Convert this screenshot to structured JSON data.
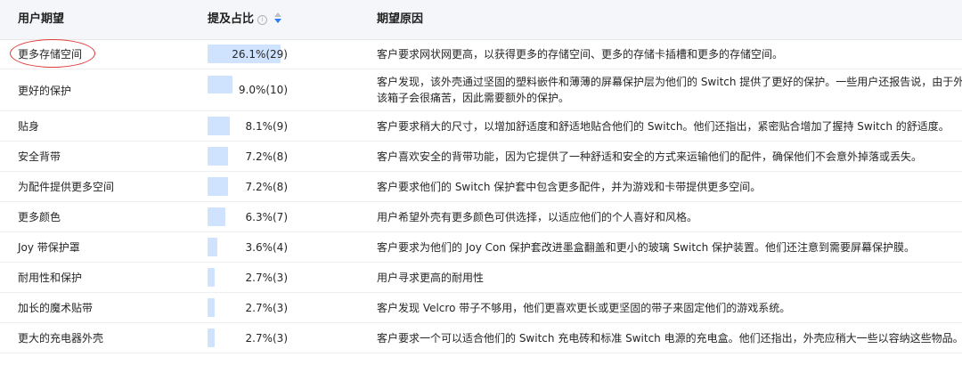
{
  "columns": {
    "expectation": "用户期望",
    "share": "提及占比",
    "info_glyph": "i",
    "reason": "期望原因"
  },
  "rows": [
    {
      "name": "更多存储空间",
      "share": 0.261,
      "pct": "26.1%(29)",
      "reason": "客户要求网状网更高，以获得更多的存储空间、更多的存储卡插槽和更多的存储空间。"
    },
    {
      "name": "更好的保护",
      "share": 0.09,
      "pct": "9.0%(10)",
      "reason": "客户发现，该外壳通过坚固的塑料嵌件和薄薄的屏幕保护层为他们的 Switch 提供了更好的保护。一些用户还报告说，由于外",
      "reason2": "该箱子会很痛苦，因此需要额外的保护。"
    },
    {
      "name": "贴身",
      "share": 0.081,
      "pct": "8.1%(9)",
      "reason": "客户要求稍大的尺寸，以增加舒适度和舒适地贴合他们的 Switch。他们还指出，紧密贴合增加了握持 Switch 的舒适度。"
    },
    {
      "name": "安全背带",
      "share": 0.072,
      "pct": "7.2%(8)",
      "reason": "客户喜欢安全的背带功能，因为它提供了一种舒适和安全的方式来运输他们的配件，确保他们不会意外掉落或丢失。"
    },
    {
      "name": "为配件提供更多空间",
      "share": 0.072,
      "pct": "7.2%(8)",
      "reason": "客户要求他们的 Switch 保护套中包含更多配件，并为游戏和卡带提供更多空间。"
    },
    {
      "name": "更多颜色",
      "share": 0.063,
      "pct": "6.3%(7)",
      "reason": "用户希望外壳有更多颜色可供选择，以适应他们的个人喜好和风格。"
    },
    {
      "name": "Joy 带保护罩",
      "share": 0.036,
      "pct": "3.6%(4)",
      "reason": "客户要求为他们的 Joy Con 保护套改进墨盒翻盖和更小的玻璃 Switch 保护装置。他们还注意到需要屏幕保护膜。"
    },
    {
      "name": "耐用性和保护",
      "share": 0.027,
      "pct": "2.7%(3)",
      "reason": "用户寻求更高的耐用性"
    },
    {
      "name": "加长的魔术贴带",
      "share": 0.027,
      "pct": "2.7%(3)",
      "reason": "客户发现 Velcro 带子不够用，他们更喜欢更长或更坚固的带子来固定他们的游戏系统。"
    },
    {
      "name": "更大的充电器外壳",
      "share": 0.027,
      "pct": "2.7%(3)",
      "reason": "客户要求一个可以适合他们的 Switch 充电砖和标准 Switch 电源的充电盒。他们还指出，外壳应稍大一些以容纳这些物品。"
    }
  ],
  "colors": {
    "bar": "#cfe3ff",
    "header_bg": "#f4f6f9",
    "sort_active": "#2f7bf5",
    "annotation": "#e03a3a"
  }
}
